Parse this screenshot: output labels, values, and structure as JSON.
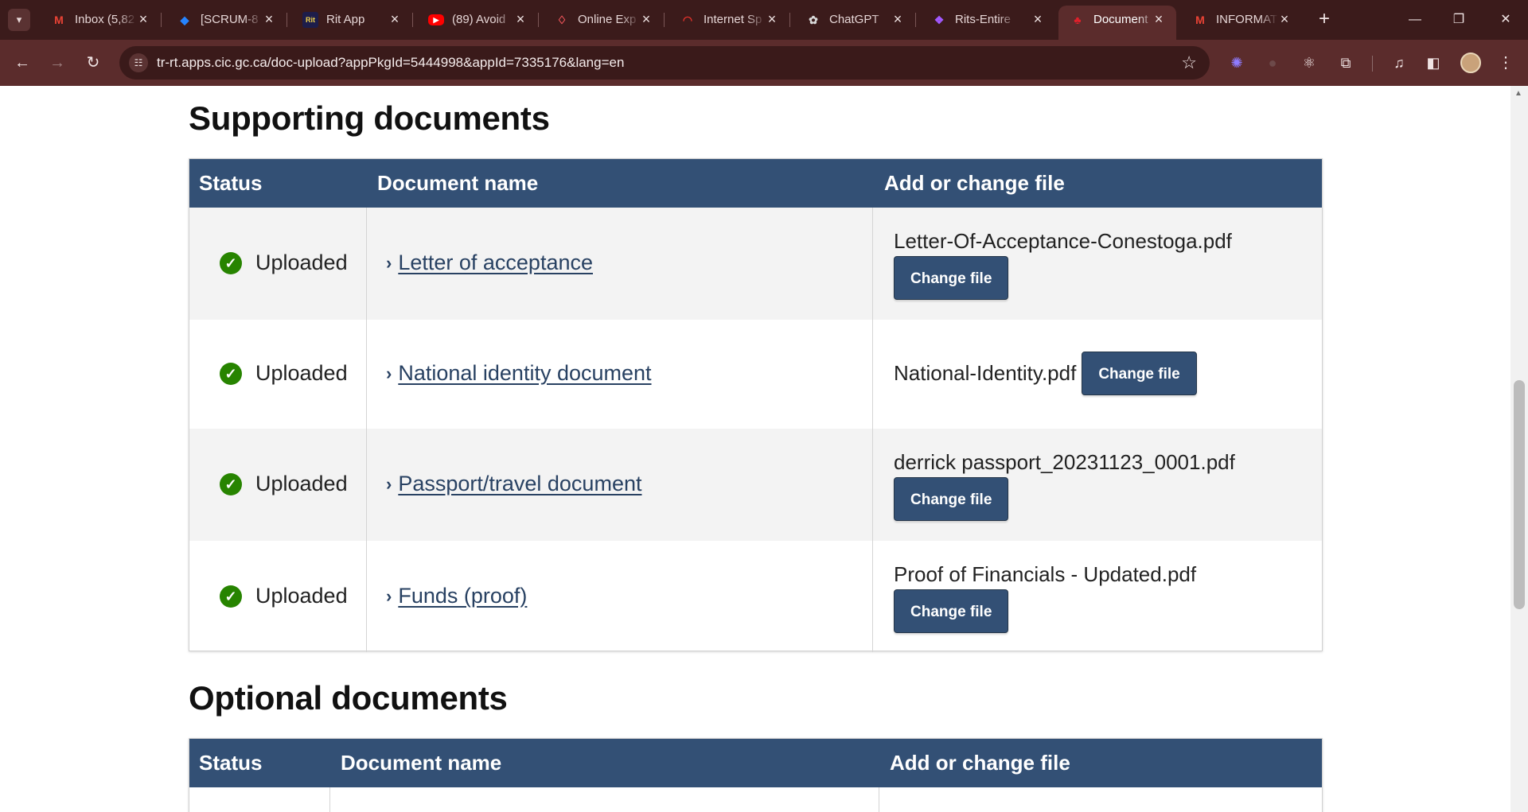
{
  "browser": {
    "tabs": [
      {
        "title": "Inbox (5,82",
        "icon": "gmail-icon"
      },
      {
        "title": "[SCRUM-8",
        "icon": "jira-icon"
      },
      {
        "title": "Rit App",
        "icon": "rit-icon",
        "badge": "Rit"
      },
      {
        "title": "(89) Avoid",
        "icon": "youtube-icon"
      },
      {
        "title": "Online Exp",
        "icon": "airbnb-icon"
      },
      {
        "title": "Internet Sp",
        "icon": "speedtest-icon"
      },
      {
        "title": "ChatGPT",
        "icon": "chatgpt-icon"
      },
      {
        "title": "Rits-Entire",
        "icon": "figma-icon"
      },
      {
        "title": "Document",
        "icon": "maple-leaf-icon",
        "active": true
      },
      {
        "title": "INFORMAT",
        "icon": "gmail-icon"
      }
    ],
    "url": "tr-rt.apps.cic.gc.ca/doc-upload?appPkgId=5444998&appId=7335176&lang=en",
    "colors": {
      "frame": "#3b1b1b",
      "toolbar": "#5b2c2c",
      "omnibox": "#3a1a1a"
    }
  },
  "supporting": {
    "title": "Supporting documents",
    "headers": {
      "status": "Status",
      "name": "Document name",
      "file": "Add or change file"
    },
    "rows": [
      {
        "status": "Uploaded",
        "name": "Letter of acceptance",
        "file": "Letter-Of-Acceptance-Conestoga.pdf",
        "button": "Change file"
      },
      {
        "status": "Uploaded",
        "name": "National identity document",
        "file": "National-Identity.pdf",
        "button": "Change file"
      },
      {
        "status": "Uploaded",
        "name": "Passport/travel document",
        "file": "derrick passport_20231123_0001.pdf",
        "button": "Change file"
      },
      {
        "status": "Uploaded",
        "name": "Funds (proof)",
        "file": "Proof of Financials - Updated.pdf",
        "button": "Change file"
      }
    ]
  },
  "optional": {
    "title": "Optional documents",
    "headers": {
      "status": "Status",
      "name": "Document name",
      "file": "Add or change file"
    }
  },
  "colors": {
    "table_header": "#335075",
    "link": "#284162",
    "success": "#278400",
    "row_alt": "#f3f3f3"
  }
}
